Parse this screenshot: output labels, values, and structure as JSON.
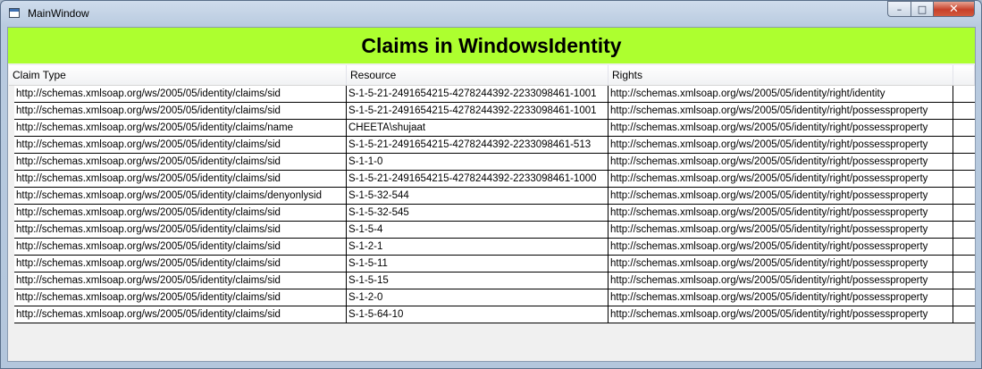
{
  "window": {
    "title": "MainWindow"
  },
  "header": {
    "title": "Claims in WindowsIdentity",
    "color": "#adff2f"
  },
  "grid": {
    "columns": [
      "Claim Type",
      "Resource",
      "Rights"
    ],
    "rows": [
      [
        "http://schemas.xmlsoap.org/ws/2005/05/identity/claims/sid",
        "S-1-5-21-2491654215-4278244392-2233098461-1001",
        "http://schemas.xmlsoap.org/ws/2005/05/identity/right/identity"
      ],
      [
        "http://schemas.xmlsoap.org/ws/2005/05/identity/claims/sid",
        "S-1-5-21-2491654215-4278244392-2233098461-1001",
        "http://schemas.xmlsoap.org/ws/2005/05/identity/right/possessproperty"
      ],
      [
        "http://schemas.xmlsoap.org/ws/2005/05/identity/claims/name",
        "CHEETA\\shujaat",
        "http://schemas.xmlsoap.org/ws/2005/05/identity/right/possessproperty"
      ],
      [
        "http://schemas.xmlsoap.org/ws/2005/05/identity/claims/sid",
        "S-1-5-21-2491654215-4278244392-2233098461-513",
        "http://schemas.xmlsoap.org/ws/2005/05/identity/right/possessproperty"
      ],
      [
        "http://schemas.xmlsoap.org/ws/2005/05/identity/claims/sid",
        "S-1-1-0",
        "http://schemas.xmlsoap.org/ws/2005/05/identity/right/possessproperty"
      ],
      [
        "http://schemas.xmlsoap.org/ws/2005/05/identity/claims/sid",
        "S-1-5-21-2491654215-4278244392-2233098461-1000",
        "http://schemas.xmlsoap.org/ws/2005/05/identity/right/possessproperty"
      ],
      [
        "http://schemas.xmlsoap.org/ws/2005/05/identity/claims/denyonlysid",
        "S-1-5-32-544",
        "http://schemas.xmlsoap.org/ws/2005/05/identity/right/possessproperty"
      ],
      [
        "http://schemas.xmlsoap.org/ws/2005/05/identity/claims/sid",
        "S-1-5-32-545",
        "http://schemas.xmlsoap.org/ws/2005/05/identity/right/possessproperty"
      ],
      [
        "http://schemas.xmlsoap.org/ws/2005/05/identity/claims/sid",
        "S-1-5-4",
        "http://schemas.xmlsoap.org/ws/2005/05/identity/right/possessproperty"
      ],
      [
        "http://schemas.xmlsoap.org/ws/2005/05/identity/claims/sid",
        "S-1-2-1",
        "http://schemas.xmlsoap.org/ws/2005/05/identity/right/possessproperty"
      ],
      [
        "http://schemas.xmlsoap.org/ws/2005/05/identity/claims/sid",
        "S-1-5-11",
        "http://schemas.xmlsoap.org/ws/2005/05/identity/right/possessproperty"
      ],
      [
        "http://schemas.xmlsoap.org/ws/2005/05/identity/claims/sid",
        "S-1-5-15",
        "http://schemas.xmlsoap.org/ws/2005/05/identity/right/possessproperty"
      ],
      [
        "http://schemas.xmlsoap.org/ws/2005/05/identity/claims/sid",
        "S-1-2-0",
        "http://schemas.xmlsoap.org/ws/2005/05/identity/right/possessproperty"
      ],
      [
        "http://schemas.xmlsoap.org/ws/2005/05/identity/claims/sid",
        "S-1-5-64-10",
        "http://schemas.xmlsoap.org/ws/2005/05/identity/right/possessproperty"
      ]
    ]
  },
  "icons": {
    "app": "window-icon",
    "minimize": "minimize-icon",
    "maximize": "maximize-icon",
    "close": "close-icon"
  }
}
